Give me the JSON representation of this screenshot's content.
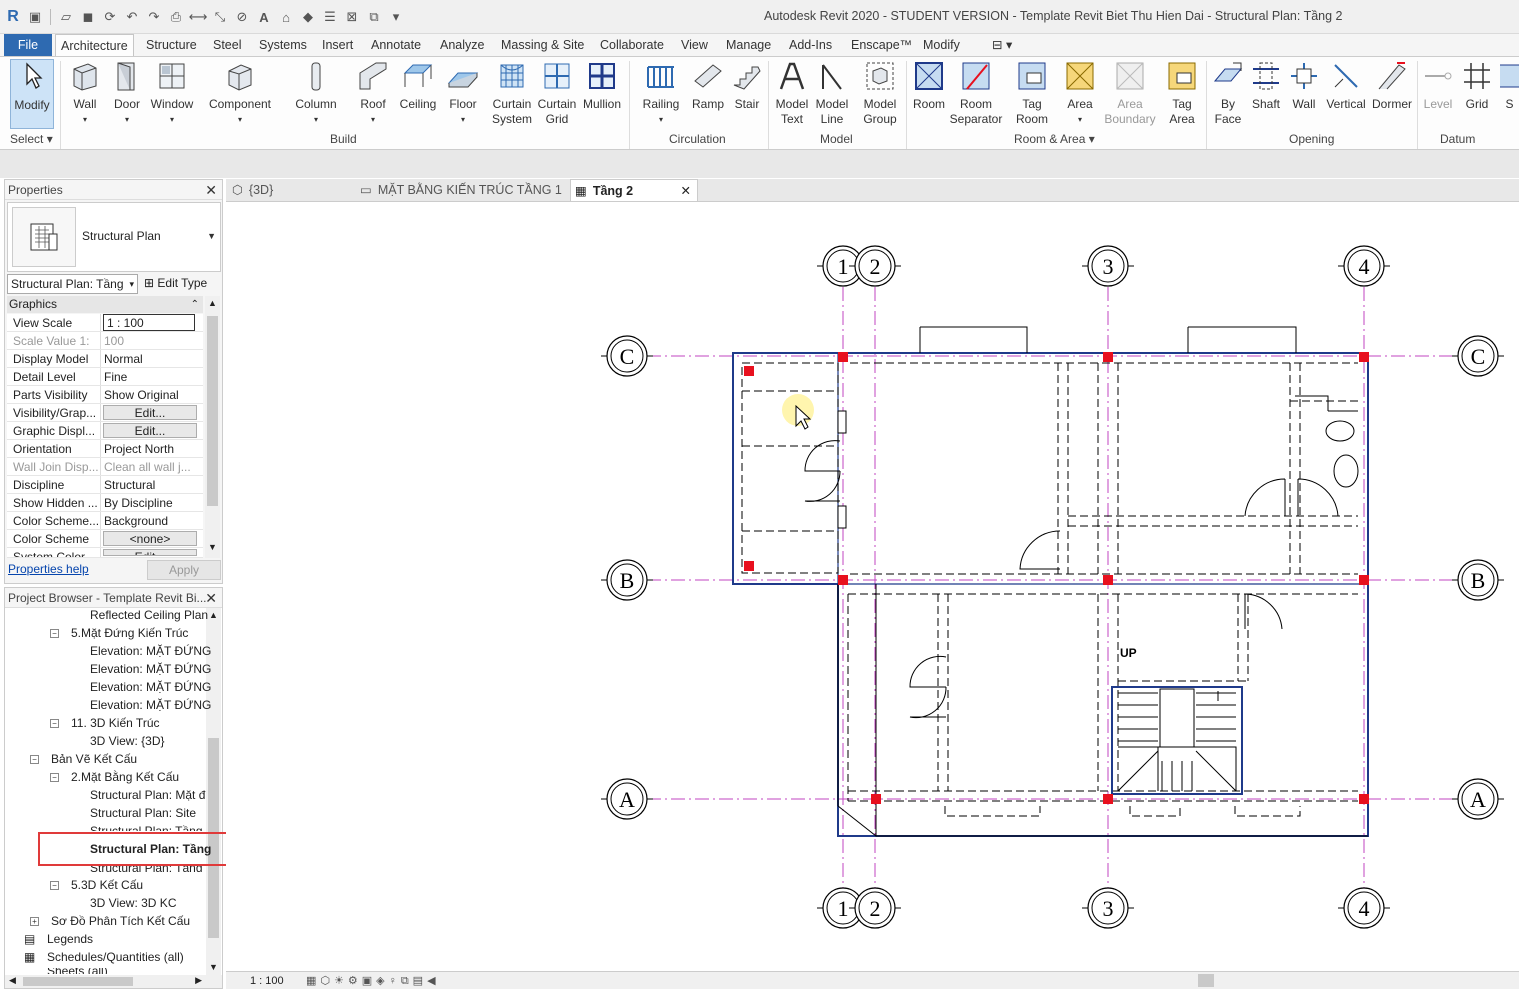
{
  "window": {
    "title": "Autodesk Revit 2020 - STUDENT VERSION - Template Revit Biet Thu Hien Dai - Structural Plan: Tầng 2"
  },
  "menu": {
    "file": "File",
    "tabs": [
      "Architecture",
      "Structure",
      "Steel",
      "Systems",
      "Insert",
      "Annotate",
      "Analyze",
      "Massing & Site",
      "Collaborate",
      "View",
      "Manage",
      "Add-Ins",
      "Enscape™",
      "Modify"
    ]
  },
  "ribbon": {
    "modify": "Modify",
    "select": "Select",
    "build": [
      "Wall",
      "Door",
      "Window",
      "Component",
      "Column",
      "Roof",
      "Ceiling",
      "Floor"
    ],
    "curtain_system": [
      "Curtain",
      "System"
    ],
    "curtain_grid": [
      "Curtain",
      "Grid"
    ],
    "mullion": "Mullion",
    "circulation": [
      "Railing",
      "Ramp",
      "Stair"
    ],
    "model_text": [
      "Model",
      "Text"
    ],
    "model_line": [
      "Model",
      "Line"
    ],
    "model_group": [
      "Model",
      "Group"
    ],
    "room": "Room",
    "room_separator": [
      "Room",
      "Separator"
    ],
    "tag_room": [
      "Tag",
      "Room"
    ],
    "area": "Area",
    "area_boundary": [
      "Area",
      "Boundary"
    ],
    "tag_area": [
      "Tag",
      "Area"
    ],
    "by_face": [
      "By",
      "Face"
    ],
    "shaft": "Shaft",
    "wall_opening": "Wall",
    "vertical": "Vertical",
    "dormer": "Dormer",
    "level": "Level",
    "grid": "Grid",
    "s": "S",
    "panels": {
      "select": "Select",
      "build": "Build",
      "circulation": "Circulation",
      "model": "Model",
      "room_area": "Room & Area",
      "opening": "Opening",
      "datum": "Datum"
    }
  },
  "properties": {
    "title": "Properties",
    "type_name": "Structural Plan",
    "view_selector": "Structural Plan: Tầng",
    "edit_type": "Edit Type",
    "group": "Graphics",
    "rows": [
      {
        "k": "View Scale",
        "v": "1 : 100"
      },
      {
        "k": "Scale Value    1:",
        "v": "100"
      },
      {
        "k": "Display Model",
        "v": "Normal"
      },
      {
        "k": "Detail Level",
        "v": "Fine"
      },
      {
        "k": "Parts Visibility",
        "v": "Show Original"
      },
      {
        "k": "Visibility/Grap...",
        "v": "Edit..."
      },
      {
        "k": "Graphic Displ...",
        "v": "Edit..."
      },
      {
        "k": "Orientation",
        "v": "Project North"
      },
      {
        "k": "Wall Join Disp...",
        "v": "Clean all wall j..."
      },
      {
        "k": "Discipline",
        "v": "Structural"
      },
      {
        "k": "Show Hidden ...",
        "v": "By Discipline"
      },
      {
        "k": "Color Scheme...",
        "v": "Background"
      },
      {
        "k": "Color Scheme",
        "v": "<none>"
      },
      {
        "k": "System Color ...",
        "v": "Edit..."
      }
    ],
    "help": "Properties help",
    "apply": "Apply"
  },
  "browser": {
    "title": "Project Browser - Template Revit Bi...",
    "items": [
      "Reflected Ceiling Plan",
      "5.Mặt Đứng Kiến Trúc",
      "Elevation: MẶT ĐỨNG",
      "Elevation: MẶT ĐỨNG",
      "Elevation: MẶT ĐỨNG",
      "Elevation: MẶT ĐỨNG",
      "11. 3D Kiến Trúc",
      "3D View: {3D}",
      "Bản Vẽ Kết Cấu",
      "2.Mặt Bằng Kết Cấu",
      "Structural Plan: Mặt đ",
      "Structural Plan: Site",
      "Structural Plan: Tầng",
      "Structural Plan: Tầng",
      "Structural Plan: Tầng",
      "5.3D Kết Cấu",
      "3D View: 3D KC",
      "Sơ Đồ Phân Tích Kết Cấu",
      "Legends",
      "Schedules/Quantities (all)",
      "Sheets (all)"
    ]
  },
  "view_tabs": [
    "{3D}",
    "MẶT BẰNG KIẾN TRÚC TẦNG 1",
    "Tầng 2"
  ],
  "drawing": {
    "grid_cols": [
      "1",
      "2",
      "3",
      "4"
    ],
    "grid_rows": [
      "C",
      "B",
      "A"
    ],
    "stair_label": "UP"
  },
  "status": {
    "scale": "1 : 100"
  },
  "colors": {
    "accent": "#2e6ab1",
    "column": "#e8101e",
    "grid_line": "#c044c0",
    "wall": "#1f3a8a"
  }
}
